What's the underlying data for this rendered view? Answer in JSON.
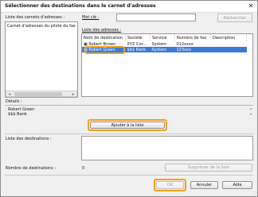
{
  "window": {
    "title": "Sélectionner des destinations dans le carnet d'adresses",
    "close_glyph": "✕"
  },
  "address_books": {
    "label": "Liste des carnets d'adresses :",
    "items": [
      "Carnet d'adresses du pilote du fax C"
    ]
  },
  "search": {
    "label": "Mot clé :",
    "value": "",
    "button": "Rechercher"
  },
  "addresses": {
    "label": "Liste des adresses :",
    "columns": [
      "Nom de destination",
      "Société",
      "Service",
      "Numéro de fax",
      "Description"
    ],
    "rows": [
      {
        "name": "Robert Brown",
        "company": "XYZ Cor...",
        "service": "System",
        "fax": "012xxxx",
        "description": "",
        "selected": false
      },
      {
        "name": "Robert Green",
        "company": "$$$ Bank",
        "service": "System",
        "fax": "123xxx",
        "description": "",
        "selected": true
      }
    ]
  },
  "details": {
    "label": "Détails :",
    "lines": [
      "Robert Green",
      "$$$ Bank"
    ]
  },
  "add_button": "Ajouter à la liste",
  "destinations": {
    "label": "Liste des destinations :"
  },
  "count": {
    "label": "Nombre de destinations :",
    "value": "0"
  },
  "delete_button": "Supprimer de la liste",
  "footer": {
    "ok": "OK",
    "cancel": "Annuler",
    "help": "Aide"
  },
  "colors": {
    "accent": "#f2a01b",
    "selection": "#3a7bd5"
  }
}
